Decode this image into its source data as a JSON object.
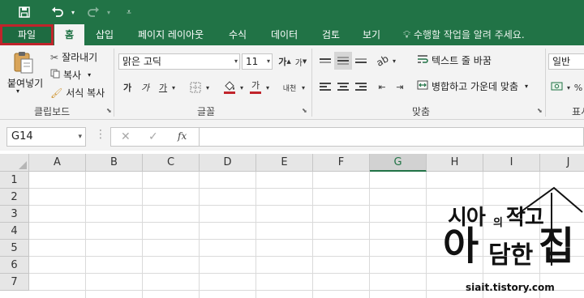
{
  "titlebar": {
    "save_icon": "save-icon",
    "undo_icon": "undo-icon",
    "redo_icon": "redo-icon",
    "customize_icon": "customize-qat-icon"
  },
  "tabs": [
    "파일",
    "홈",
    "삽입",
    "페이지 레이아웃",
    "수식",
    "데이터",
    "검토",
    "보기"
  ],
  "tell_me": "수행할 작업을 알려 주세요.",
  "clipboard": {
    "paste": "붙여넣기",
    "cut": "잘라내기",
    "copy": "복사",
    "format_painter": "서식 복사",
    "label": "클립보드"
  },
  "font": {
    "name": "맑은 고딕",
    "size": "11",
    "bold": "가",
    "italic": "가",
    "underline": "가",
    "grow": "가",
    "shrink": "가",
    "color_letter": "가",
    "phonetic": "내천",
    "label": "글꼴"
  },
  "alignment": {
    "wrap_text": "텍스트 줄 바꿈",
    "merge_center": "병합하고 가운데 맞춤",
    "label": "맞춤"
  },
  "number": {
    "format": "일반",
    "percent": "%",
    "label": "표시"
  },
  "formula_bar": {
    "name_box": "G14",
    "cancel": "✕",
    "enter": "✓",
    "fx": "fx"
  },
  "grid": {
    "columns": [
      "A",
      "B",
      "C",
      "D",
      "E",
      "F",
      "G",
      "H",
      "I",
      "J"
    ],
    "selected_column": "G",
    "rows": [
      "1",
      "2",
      "3",
      "4",
      "5",
      "6",
      "7"
    ]
  },
  "watermark": {
    "line1": "시아의 작고",
    "line1_part1": "시아",
    "line1_part2": "의",
    "line1_part3": "작고",
    "line2_part1": "아",
    "line2_part2": "담한",
    "line2_part3": "집",
    "url": "siait.tistory.com"
  },
  "colors": {
    "brand": "#217346",
    "highlight": "#c0242b"
  }
}
